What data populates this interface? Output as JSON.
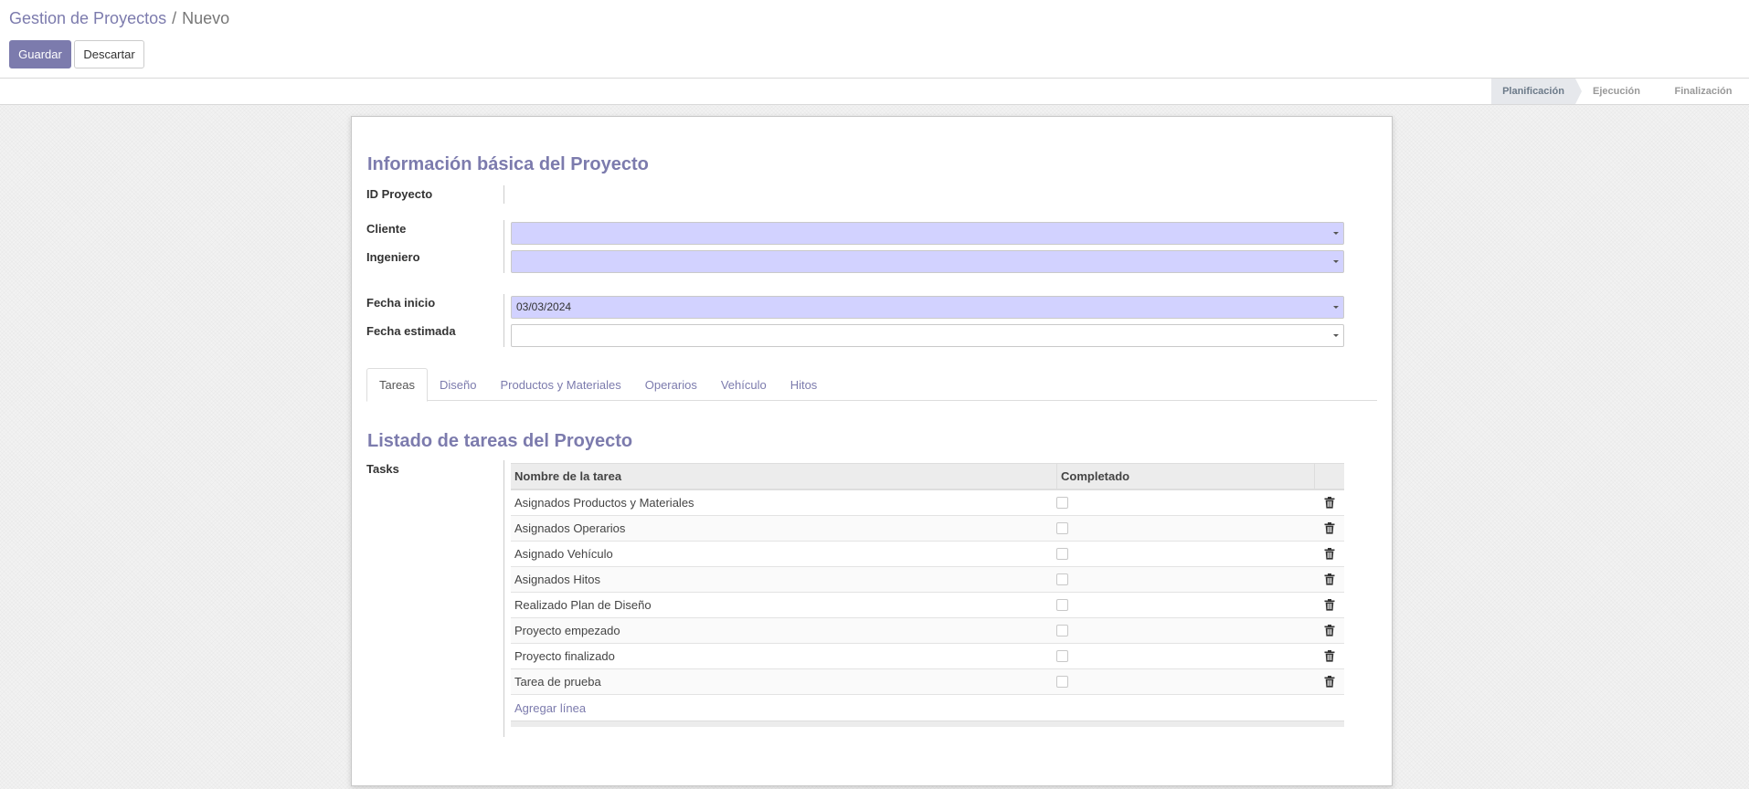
{
  "breadcrumb": {
    "parent": "Gestion de Proyectos",
    "separator": "/",
    "current": "Nuevo"
  },
  "buttons": {
    "save": "Guardar",
    "discard": "Descartar"
  },
  "statusbar": {
    "steps": [
      "Planificación",
      "Ejecución",
      "Finalización"
    ],
    "active_step": "Planificación"
  },
  "form": {
    "section1_title": "Información básica del Proyecto",
    "id_label": "ID Proyecto",
    "id_value": "",
    "cliente_label": "Cliente",
    "cliente_value": "",
    "ingeniero_label": "Ingeniero",
    "ingeniero_value": "",
    "fecha_inicio_label": "Fecha inicio",
    "fecha_inicio_value": "03/03/2024",
    "fecha_estimada_label": "Fecha estimada",
    "fecha_estimada_value": ""
  },
  "tabs": [
    "Tareas",
    "Diseño",
    "Productos y Materiales",
    "Operarios",
    "Vehículo",
    "Hitos"
  ],
  "active_tab": "Tareas",
  "tasks_section": {
    "title": "Listado de tareas del Proyecto",
    "label": "Tasks",
    "columns": [
      "Nombre de la tarea",
      "Completado"
    ],
    "rows": [
      {
        "name": "Asignados Productos y Materiales",
        "completed": false
      },
      {
        "name": "Asignados Operarios",
        "completed": false
      },
      {
        "name": "Asignado Vehículo",
        "completed": false
      },
      {
        "name": "Asignados Hitos",
        "completed": false
      },
      {
        "name": "Realizado Plan de Diseño",
        "completed": false
      },
      {
        "name": "Proyecto empezado",
        "completed": false
      },
      {
        "name": "Proyecto finalizado",
        "completed": false
      },
      {
        "name": "Tarea de prueba",
        "completed": false
      }
    ],
    "add_line": "Agregar línea"
  },
  "colors": {
    "accent": "#7c7bad",
    "required_field": "#d2d2ff"
  }
}
